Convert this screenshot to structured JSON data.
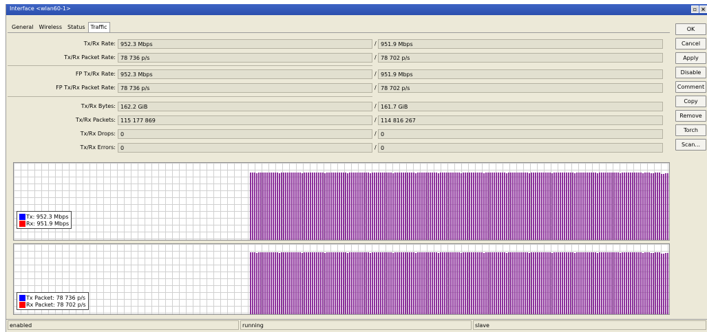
{
  "window": {
    "title": "Interface <wlan60-1>"
  },
  "tabs": [
    {
      "label": "General",
      "active": false
    },
    {
      "label": "Wireless",
      "active": false
    },
    {
      "label": "Status",
      "active": false
    },
    {
      "label": "Traffic",
      "active": true
    }
  ],
  "fields": [
    {
      "label": "Tx/Rx Rate:",
      "tx": "952.3 Mbps",
      "rx": "951.9 Mbps"
    },
    {
      "label": "Tx/Rx Packet Rate:",
      "tx": "78 736 p/s",
      "rx": "78 702 p/s"
    },
    {
      "label": "FP Tx/Rx Rate:",
      "tx": "952.3 Mbps",
      "rx": "951.9 Mbps"
    },
    {
      "label": "FP Tx/Rx Packet Rate:",
      "tx": "78 736 p/s",
      "rx": "78 702 p/s"
    },
    {
      "label": "Tx/Rx Bytes:",
      "tx": "162.2 GiB",
      "rx": "161.7 GiB"
    },
    {
      "label": "Tx/Rx Packets:",
      "tx": "115 177 869",
      "rx": "114 816 267"
    },
    {
      "label": "Tx/Rx Drops:",
      "tx": "0",
      "rx": "0"
    },
    {
      "label": "Tx/Rx Errors:",
      "tx": "0",
      "rx": "0"
    }
  ],
  "separator": "/",
  "graphs": {
    "rate": {
      "tx_label": "Tx:  952.3 Mbps",
      "rx_label": "Rx:  951.9 Mbps"
    },
    "packets": {
      "tx_label": "Tx Packet:  78 736 p/s",
      "rx_label": "Rx Packet:  78 702 p/s"
    },
    "colors": {
      "tx": "#0000ff",
      "rx": "#ff0000",
      "bars": "#8b2f9a"
    },
    "traffic_start_fraction": 0.36,
    "traffic_level_fraction": 0.88
  },
  "buttons": {
    "ok": "OK",
    "cancel": "Cancel",
    "apply": "Apply",
    "disable": "Disable",
    "comment": "Comment",
    "copy": "Copy",
    "remove": "Remove",
    "torch": "Torch",
    "scan": "Scan..."
  },
  "statusbar": {
    "state": "enabled",
    "run": "running",
    "mode": "slave"
  },
  "titlebar_icons": [
    "restore-icon",
    "close-icon"
  ]
}
